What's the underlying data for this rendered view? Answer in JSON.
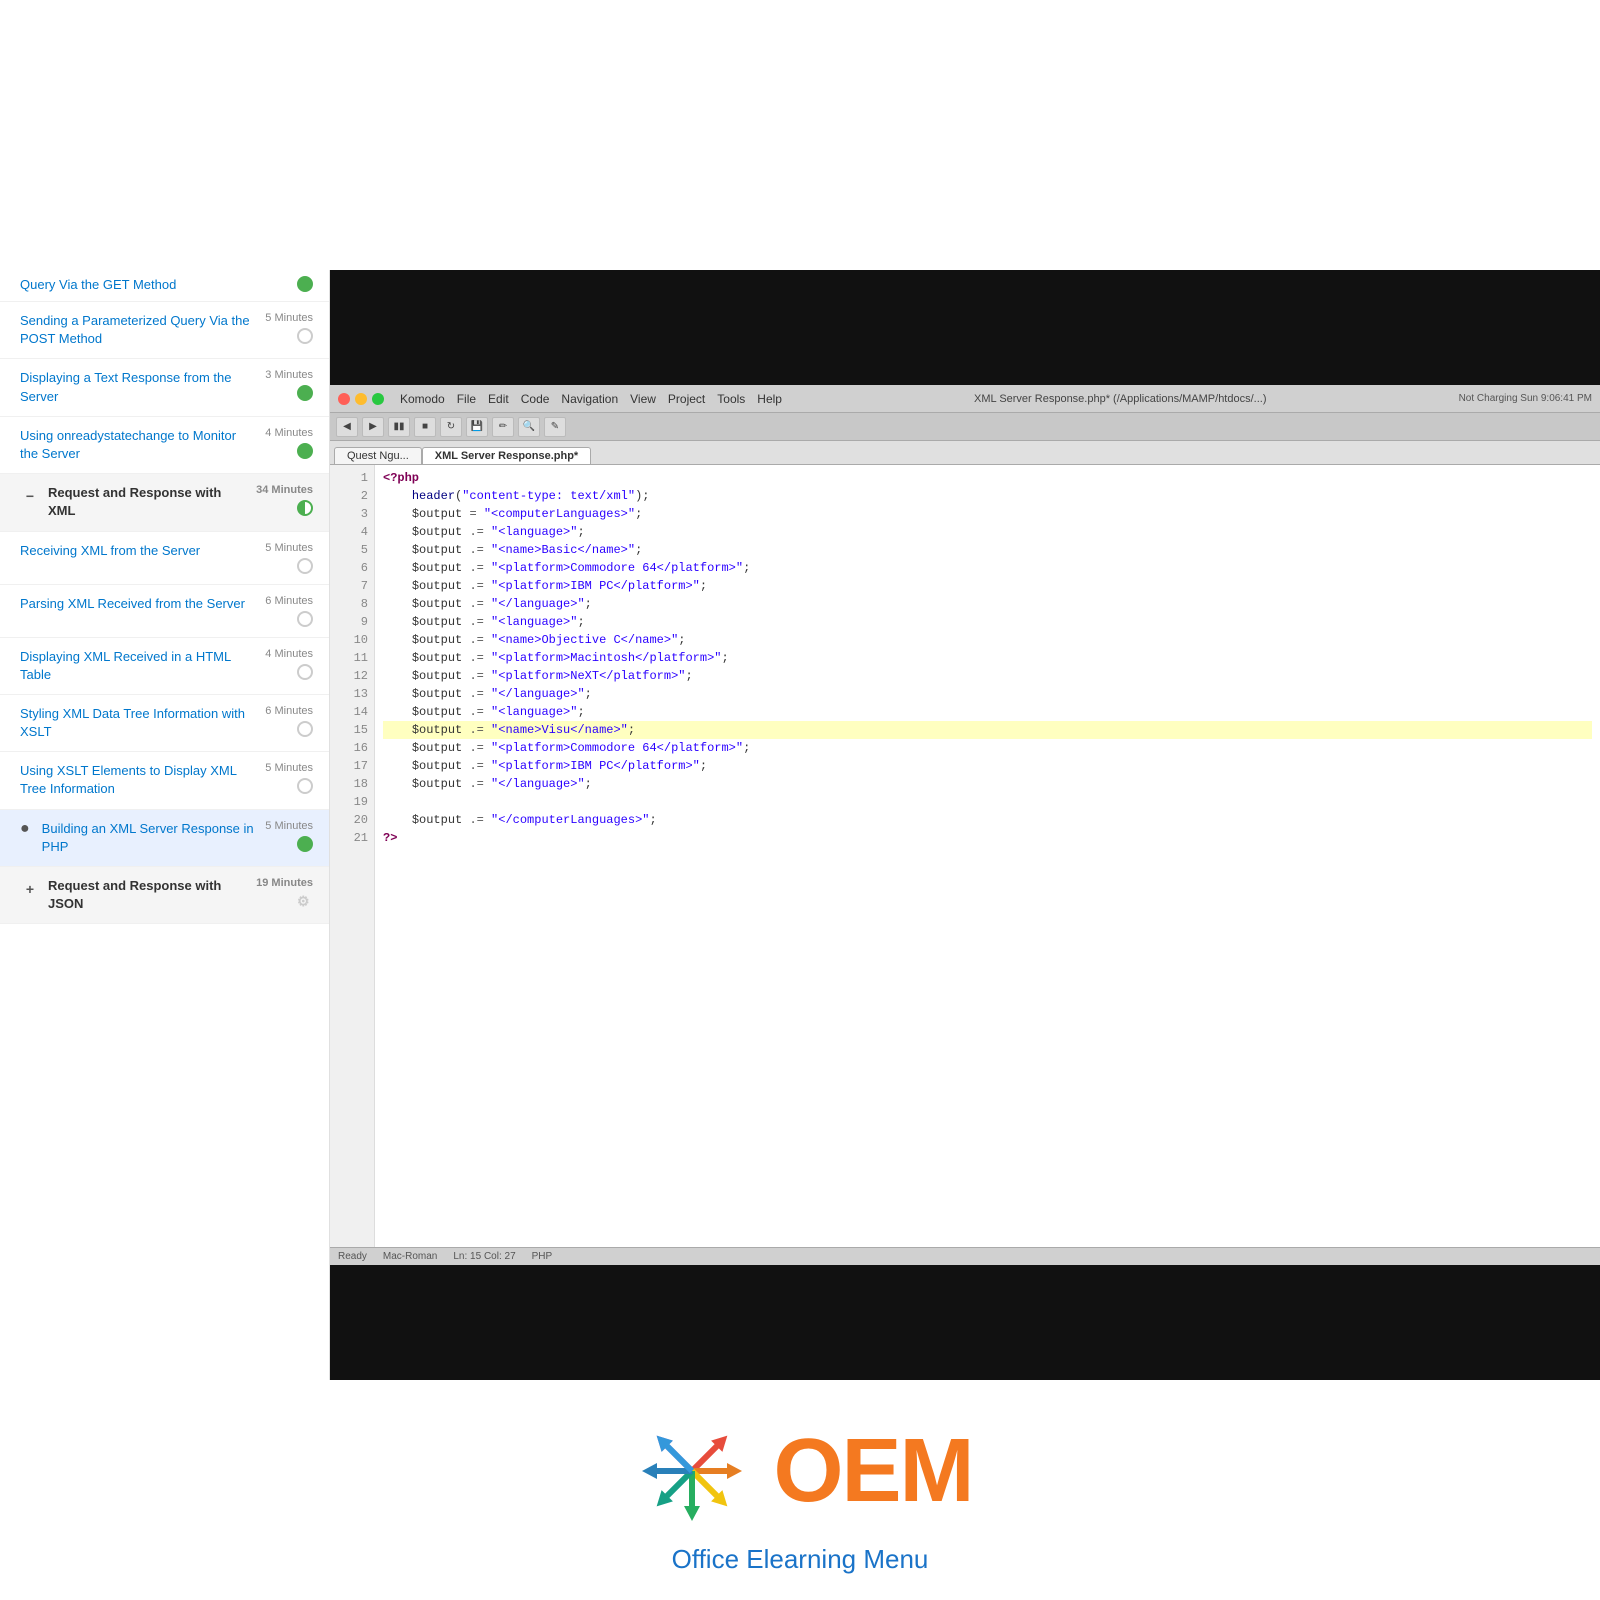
{
  "top_white_height": 270,
  "sidebar": {
    "items": [
      {
        "id": "query-get",
        "label": "Query Via the GET Method",
        "duration": "",
        "status": "green",
        "partial": true,
        "toggle": null
      },
      {
        "id": "sending-post",
        "label": "Sending a Parameterized Query Via the POST Method",
        "duration": "5 Minutes",
        "status": "empty",
        "partial": false,
        "toggle": null
      },
      {
        "id": "displaying-text",
        "label": "Displaying a Text Response from the Server",
        "duration": "3 Minutes",
        "status": "green",
        "partial": false,
        "toggle": null
      },
      {
        "id": "onreadystate",
        "label": "Using onreadystatechange to Monitor the Server",
        "duration": "4 Minutes",
        "status": "green",
        "partial": false,
        "toggle": null
      },
      {
        "id": "request-xml-header",
        "label": "Request and Response with XML",
        "duration": "34 Minutes",
        "status": "half",
        "partial": false,
        "toggle": "minus",
        "is_section": true,
        "active": true
      },
      {
        "id": "receiving-xml",
        "label": "Receiving XML from the Server",
        "duration": "5 Minutes",
        "status": "empty",
        "partial": false,
        "toggle": null
      },
      {
        "id": "parsing-xml",
        "label": "Parsing XML Received from the Server",
        "duration": "6 Minutes",
        "status": "empty",
        "partial": false,
        "toggle": null
      },
      {
        "id": "displaying-xml-table",
        "label": "Displaying XML Received in a HTML Table",
        "duration": "4 Minutes",
        "status": "empty",
        "partial": false,
        "toggle": null
      },
      {
        "id": "styling-xml",
        "label": "Styling XML Data Tree Information with XSLT",
        "duration": "6 Minutes",
        "status": "empty",
        "partial": false,
        "toggle": null
      },
      {
        "id": "using-xslt",
        "label": "Using XSLT Elements to Display XML Tree Information",
        "duration": "5 Minutes",
        "status": "empty",
        "partial": false,
        "toggle": null
      },
      {
        "id": "building-xml",
        "label": "Building an XML Server Response in PHP",
        "duration": "5 Minutes",
        "status": "green",
        "partial": false,
        "toggle": null,
        "has_dot": true
      },
      {
        "id": "request-json-header",
        "label": "Request and Response with JSON",
        "duration": "19 Minutes",
        "status": "gear",
        "partial": false,
        "toggle": "plus",
        "is_section": true
      }
    ]
  },
  "editor": {
    "title": "XML Server Response.php* (/Applications/MAMP/htdocs/...)",
    "app_name": "Komodo",
    "menus": [
      "File",
      "Edit",
      "Code",
      "Navigation",
      "View",
      "Project",
      "Tools",
      "Help"
    ],
    "tab_label": "XML Server Response.php*",
    "status_bar": {
      "left": "Ready",
      "line_col": "Ln: 15 Col: 27",
      "file_type": "PHP"
    },
    "code_lines": [
      {
        "num": 1,
        "code": "<?php",
        "type": "php-tag"
      },
      {
        "num": 2,
        "code": "    header(\"content-type: text/xml\");",
        "type": "normal"
      },
      {
        "num": 3,
        "code": "    $output = \"<computerLanguages>\";",
        "type": "normal"
      },
      {
        "num": 4,
        "code": "    $output .= \"<language>\";",
        "type": "normal"
      },
      {
        "num": 5,
        "code": "    $output .= \"<name>Basic</name>\";",
        "type": "normal"
      },
      {
        "num": 6,
        "code": "    $output .= \"<platform>Commodore 64</platform>\";",
        "type": "normal"
      },
      {
        "num": 7,
        "code": "    $output .= \"<platform>IBM PC</platform>\";",
        "type": "normal"
      },
      {
        "num": 8,
        "code": "    $output .= \"</language>\";",
        "type": "normal"
      },
      {
        "num": 9,
        "code": "    $output .= \"<language>\";",
        "type": "normal"
      },
      {
        "num": 10,
        "code": "    $output .= \"<name>Objective C</name>\";",
        "type": "normal"
      },
      {
        "num": 11,
        "code": "    $output .= \"<platform>Macintosh</platform>\";",
        "type": "normal"
      },
      {
        "num": 12,
        "code": "    $output .= \"<platform>NeXT</platform>\";",
        "type": "normal"
      },
      {
        "num": 13,
        "code": "    $output .= \"</language>\";",
        "type": "normal"
      },
      {
        "num": 14,
        "code": "    $output .= \"<language>\";",
        "type": "normal"
      },
      {
        "num": 15,
        "code": "    $output .= \"<name>Visu</name>\";",
        "type": "highlighted"
      },
      {
        "num": 16,
        "code": "    $output .= \"<platform>Commodore 64</platform>\";",
        "type": "normal"
      },
      {
        "num": 17,
        "code": "    $output .= \"<platform>IBM PC</platform>\";",
        "type": "normal"
      },
      {
        "num": 18,
        "code": "    $output .= \"</language>\";",
        "type": "normal"
      },
      {
        "num": 19,
        "code": "",
        "type": "normal"
      },
      {
        "num": 20,
        "code": "    $output .= \"</computerLanguages>\";",
        "type": "normal"
      },
      {
        "num": 21,
        "code": "?>",
        "type": "php-tag"
      }
    ]
  },
  "logo": {
    "brand_name": "OEM",
    "subtitle": "Office Elearning Menu",
    "brand_color": "#f47920",
    "subtitle_color": "#1a73c8"
  }
}
